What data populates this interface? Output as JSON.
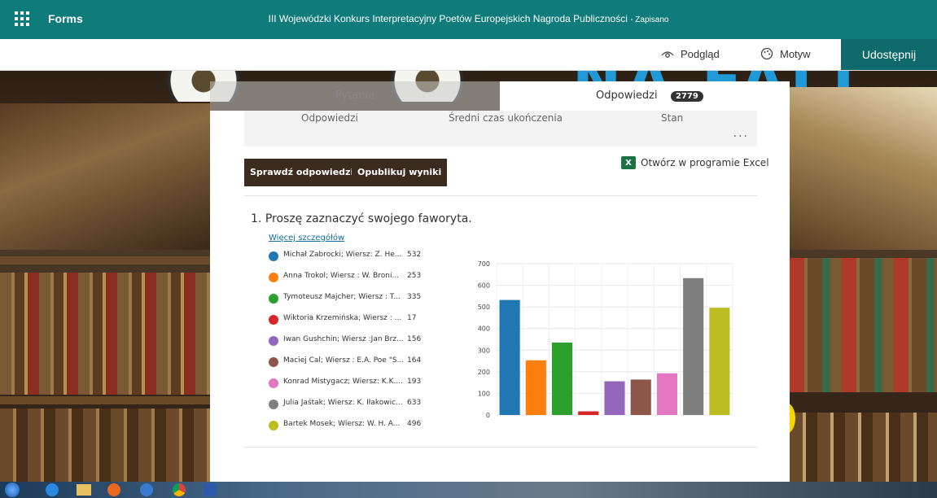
{
  "appbar": {
    "app_name": "Forms",
    "title": "III Wojewódzki Konkurs Interpretacyjny Poetów Europejskich Nagroda Publiczności",
    "saved_status": "- Zapisano"
  },
  "commandbar": {
    "preview": "Podgląd",
    "theme": "Motyw",
    "share": "Udostępnij"
  },
  "tabs": {
    "questions": "Pytania",
    "responses": "Odpowiedzi",
    "responses_count": "2779"
  },
  "stats": {
    "responses": "Odpowiedzi",
    "avg_time": "Średni czas ukończenia",
    "status": "Stan",
    "more": "..."
  },
  "actions": {
    "check": "Sprawdź odpowiedzi",
    "publish": "Opublikuj wyniki",
    "excel": "Otwórz w programie Excel",
    "excel_icon": "X"
  },
  "question": {
    "number": "1.",
    "text": "Proszę zaznaczyć swojego faworyta.",
    "more_details": "Więcej szczegółów",
    "options": [
      {
        "label": "Michał Zabrocki; Wiersz: Z. He...",
        "count": "532",
        "color": "#1f77b4"
      },
      {
        "label": "Anna Trokol; Wiersz : W. Broni...",
        "count": "253",
        "color": "#ff7f0e"
      },
      {
        "label": "Tymoteusz Majcher; Wiersz : T...",
        "count": "335",
        "color": "#2ca02c"
      },
      {
        "label": "Wiktoria Krzemińska; Wiersz : ...",
        "count": "17",
        "color": "#d62728"
      },
      {
        "label": "Iwan Gushchin; Wiersz :Jan Brz...",
        "count": "156",
        "color": "#9467bd"
      },
      {
        "label": "Maciej Cal; Wiersz : E.A. Poe \"S...",
        "count": "164",
        "color": "#8c564b"
      },
      {
        "label": "Konrad Mistygacz; Wiersz: K.K....",
        "count": "193",
        "color": "#e377c2"
      },
      {
        "label": "Julia Jaśtak; Wiersz: K. Iłakowic...",
        "count": "633",
        "color": "#7f7f7f"
      },
      {
        "label": "Bartek Mosek; Wiersz: W. H. A...",
        "count": "496",
        "color": "#bcbd22"
      }
    ]
  },
  "chart_data": {
    "type": "bar",
    "values": [
      532,
      253,
      335,
      17,
      156,
      164,
      193,
      633,
      496
    ],
    "colors": [
      "#1f77b4",
      "#ff7f0e",
      "#2ca02c",
      "#d62728",
      "#9467bd",
      "#8c564b",
      "#e377c2",
      "#7f7f7f",
      "#bcbd22"
    ],
    "ylim": [
      0,
      700
    ],
    "yticks": [
      "0",
      "100",
      "200",
      "300",
      "400",
      "500",
      "600",
      "700"
    ],
    "grid": true
  },
  "background": {
    "banner_text": "NA FALI"
  }
}
